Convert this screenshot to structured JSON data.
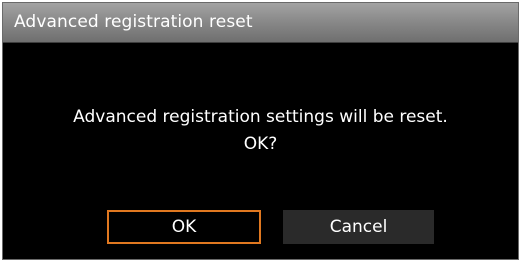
{
  "dialog": {
    "title": "Advanced registration reset",
    "message_line1": "Advanced registration settings will be reset.",
    "message_line2": "OK?",
    "ok_label": "OK",
    "cancel_label": "Cancel",
    "focused_button": "OK"
  },
  "colors": {
    "background": "#000000",
    "titlebar": "#8a8a8a",
    "focus_border": "#e07820",
    "cancel_button": "#2a2a2a",
    "text": "#ffffff"
  }
}
